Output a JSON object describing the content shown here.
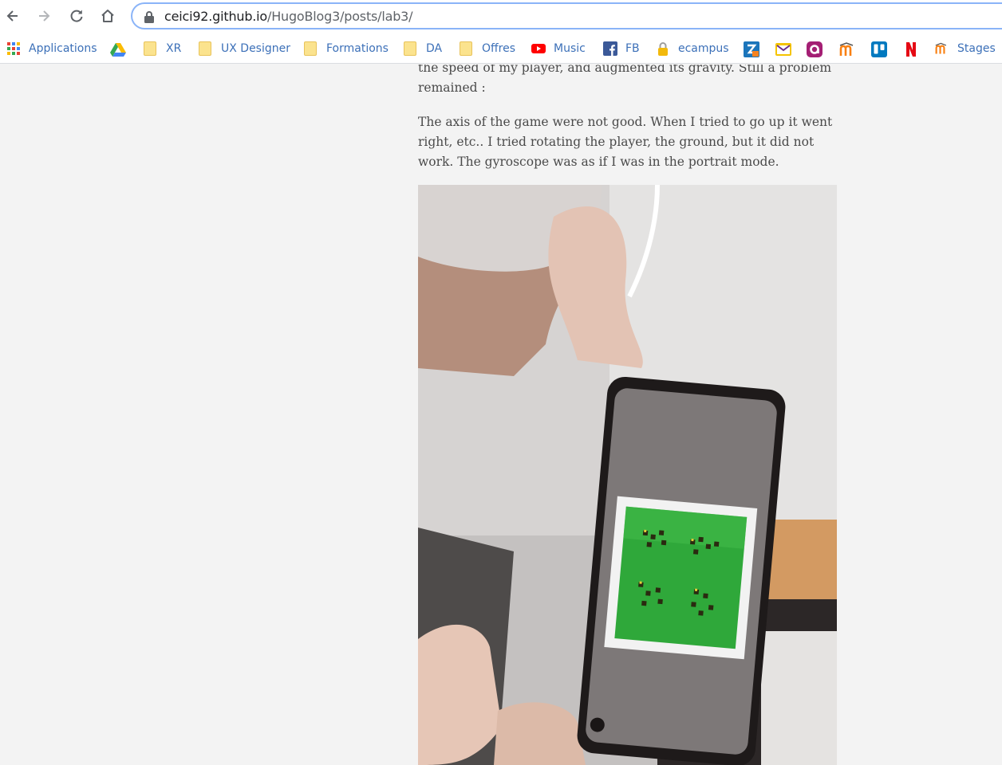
{
  "browser": {
    "url_host": "ceici92.github.io",
    "url_path": "/HugoBlog3/posts/lab3/"
  },
  "bookmarks": [
    {
      "label": "Applications",
      "icon": "apps-grid-icon"
    },
    {
      "label": "",
      "icon": "google-drive-icon"
    },
    {
      "label": "XR",
      "icon": "folder-icon"
    },
    {
      "label": "UX Designer",
      "icon": "folder-icon"
    },
    {
      "label": "Formations",
      "icon": "folder-icon"
    },
    {
      "label": "DA",
      "icon": "folder-icon"
    },
    {
      "label": "Offres",
      "icon": "folder-icon"
    },
    {
      "label": "Music",
      "icon": "youtube-icon"
    },
    {
      "label": "FB",
      "icon": "facebook-icon"
    },
    {
      "label": "ecampus",
      "icon": "lock-icon"
    },
    {
      "label": "Stages",
      "icon": "moodle-icon"
    }
  ],
  "article": {
    "paragraph_1": "the speed of my player, and augmented its gravity. Still a problem remained :",
    "paragraph_2": "The axis of the game were not good. When I tried to go up it went right, etc.. I tried rotating the player, the ground, but it did not work. The gyroscope was as if I was in the portrait mode."
  },
  "colors": {
    "accent_focus": "#8ab4f8",
    "bookmark_text": "#3c70b8",
    "body_text": "#4a4a4a",
    "page_bg": "#f3f3f3",
    "game_green": "#2fa83a"
  }
}
